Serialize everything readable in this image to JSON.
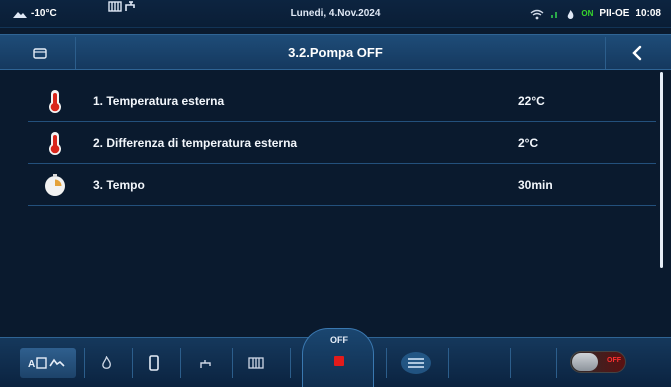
{
  "status": {
    "outside_temp": "-10°C",
    "date": "Lunedi, 4.Nov.2024",
    "on_badge": "ON",
    "controller": "PII-OE",
    "time": "10:08"
  },
  "header": {
    "title": "3.2.Pompa OFF"
  },
  "list": {
    "items": [
      {
        "label": "1.  Temperatura esterna",
        "value": "22°C",
        "icon": "thermometer-icon"
      },
      {
        "label": "2.  Differenza di temperatura esterna",
        "value": "2°C",
        "icon": "thermometer-icon"
      },
      {
        "label": "3.  Tempo",
        "value": "30min",
        "icon": "clock-icon"
      }
    ]
  },
  "bottom": {
    "mode_label": "OFF",
    "toggle_label": "OFF"
  },
  "colors": {
    "background": "#0a1a2e",
    "accent": "#1e4c78",
    "stop": "#e21b1b"
  }
}
